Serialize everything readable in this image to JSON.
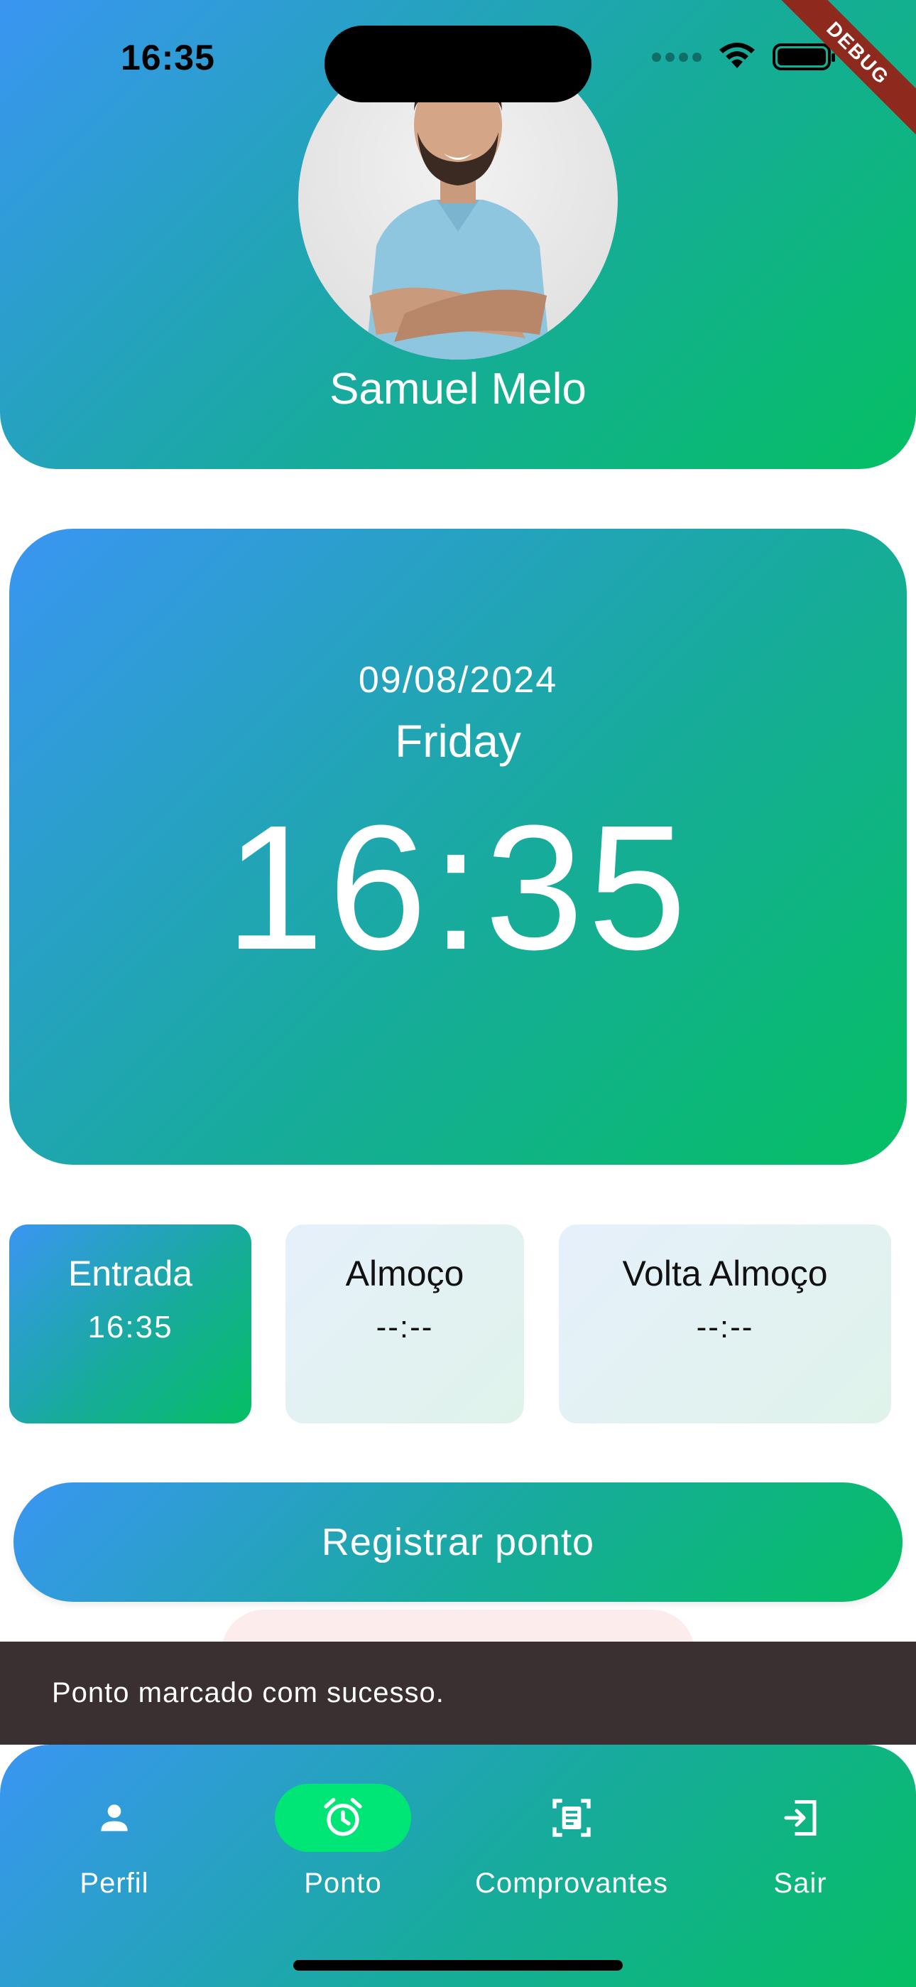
{
  "status_bar": {
    "time": "16:35"
  },
  "debug_banner": "DEBUG",
  "profile": {
    "name": "Samuel Melo"
  },
  "clock": {
    "date": "09/08/2024",
    "weekday": "Friday",
    "time": "16:35"
  },
  "punches": [
    {
      "label": "Entrada",
      "value": "16:35",
      "active": true
    },
    {
      "label": "Almoço",
      "value": "--:--",
      "active": false
    },
    {
      "label": "Volta Almoço",
      "value": "--:--",
      "active": false
    }
  ],
  "register_button": "Registrar ponto",
  "snackbar": "Ponto marcado com sucesso.",
  "nav": [
    {
      "label": "Perfil",
      "icon": "person-icon",
      "selected": false
    },
    {
      "label": "Ponto",
      "icon": "alarm-icon",
      "selected": true
    },
    {
      "label": "Comprovantes",
      "icon": "document-scan-icon",
      "selected": false
    },
    {
      "label": "Sair",
      "icon": "logout-icon",
      "selected": false
    }
  ],
  "colors": {
    "gradient_start": "#3a95f2",
    "gradient_end": "#05bf63",
    "nav_selected": "#00e676",
    "snackbar": "#3a2f31"
  }
}
